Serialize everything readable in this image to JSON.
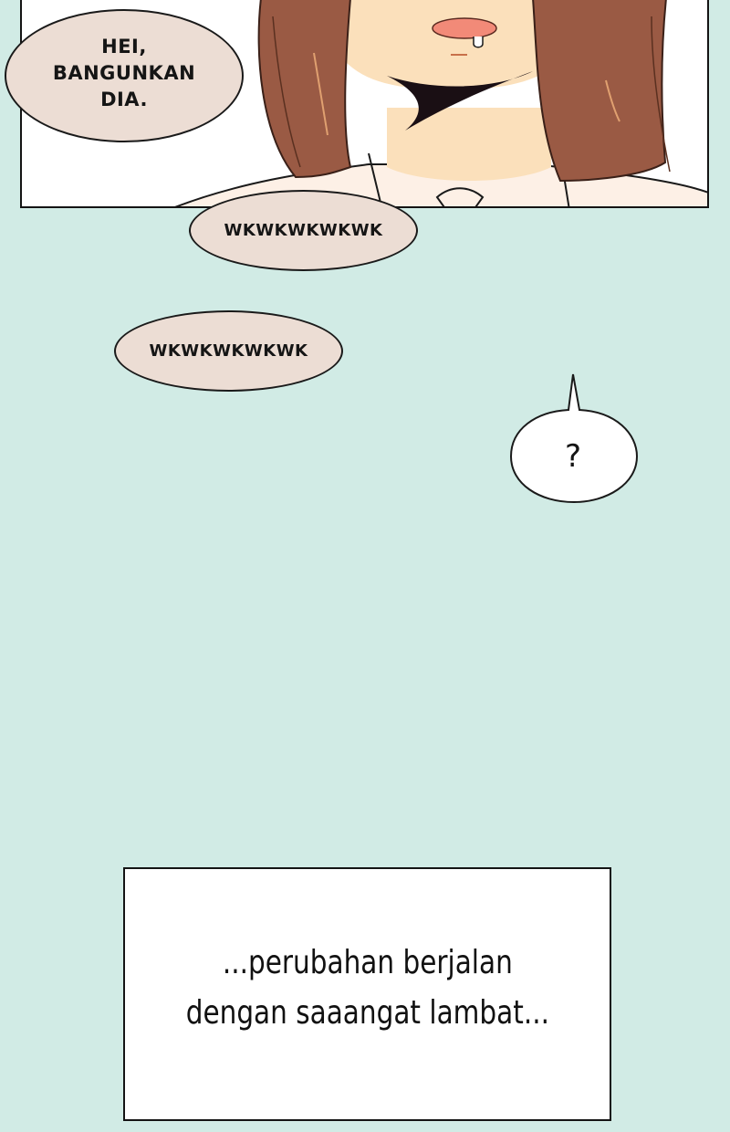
{
  "comic": {
    "panel_top": {
      "speech_bubble": "HEI,\nBANGUNKAN\nDIA."
    },
    "laugh_bubbles": [
      "WKWKWKWKWK",
      "WKWKWKWKWK"
    ],
    "question_bubble": "?",
    "narration": "...perubahan berjalan\ndengan saaangat lambat..."
  },
  "colors": {
    "background": "#d1ebe5",
    "bubble_fill": "#ecddd4",
    "hair": "#9a5a44",
    "skin": "#fbe0bb",
    "shirt": "#fdf3ea"
  }
}
